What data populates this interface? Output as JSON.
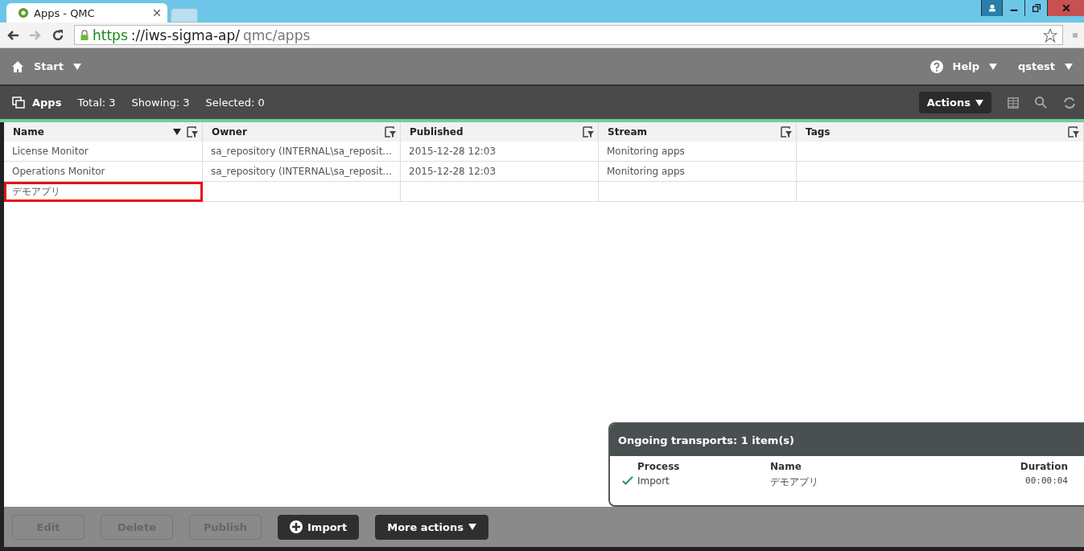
{
  "browser": {
    "tab_title": "Apps - QMC",
    "url_scheme": "https",
    "url_host": "://iws-sigma-ap/",
    "url_path": "qmc/apps"
  },
  "topbar": {
    "start": "Start",
    "help": "Help",
    "user": "qstest"
  },
  "apps_header": {
    "title": "Apps",
    "total": "Total: 3",
    "showing": "Showing: 3",
    "selected": "Selected: 0",
    "actions": "Actions"
  },
  "table": {
    "columns": [
      {
        "label": "Name",
        "sorted": true
      },
      {
        "label": "Owner",
        "sorted": false
      },
      {
        "label": "Published",
        "sorted": false
      },
      {
        "label": "Stream",
        "sorted": false
      },
      {
        "label": "Tags",
        "sorted": false
      }
    ],
    "rows": [
      {
        "cells": [
          "License Monitor",
          "sa_repository (INTERNAL\\sa_reposit...",
          "2015-12-28 12:03",
          "Monitoring apps",
          ""
        ],
        "highlighted": false
      },
      {
        "cells": [
          "Operations Monitor",
          "sa_repository (INTERNAL\\sa_reposit...",
          "2015-12-28 12:03",
          "Monitoring apps",
          ""
        ],
        "highlighted": false
      },
      {
        "cells": [
          "デモアプリ",
          "",
          "",
          "",
          ""
        ],
        "highlighted": true
      }
    ]
  },
  "transports": {
    "title": "Ongoing transports: 1 item(s)",
    "columns": [
      "Process",
      "Name",
      "Duration"
    ],
    "items": [
      {
        "process": "Import",
        "name": "デモアプリ",
        "duration": "00:00:04",
        "done": true
      }
    ]
  },
  "buttons": [
    {
      "label": "Edit",
      "kind": "plain",
      "disabled": true
    },
    {
      "label": "Delete",
      "kind": "plain",
      "disabled": true
    },
    {
      "label": "Publish",
      "kind": "plain",
      "disabled": true
    },
    {
      "label": "Import",
      "kind": "add",
      "disabled": false
    },
    {
      "label": "More actions",
      "kind": "menu",
      "disabled": false
    }
  ]
}
